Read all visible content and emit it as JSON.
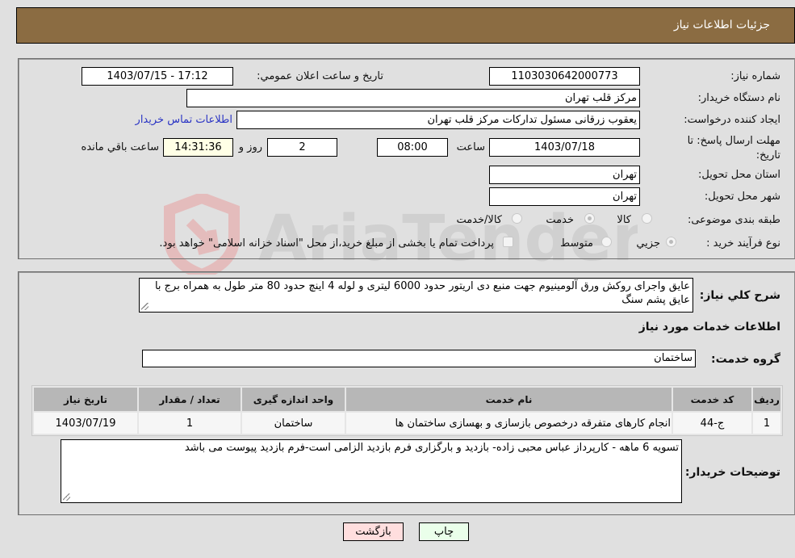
{
  "header": {
    "title": "جزئيات اطلاعات نياز"
  },
  "details": {
    "need_number": {
      "label": "شماره نياز:",
      "value": "1103030642000773"
    },
    "announce_datetime": {
      "label": "تاريخ و ساعت اعلان عمومي:",
      "value": "1403/07/15 - 17:12"
    },
    "buyer_org": {
      "label": "نام دستگاه خريدار:",
      "value": "مرکز قلب تهران"
    },
    "requester": {
      "label": "ايجاد كننده درخواست:",
      "value": "یعقوب زرقانی مسئول تداركات مرکز قلب تهران"
    },
    "buyer_contact_link": "اطلاعات تماس خريدار",
    "deadline": {
      "label": "مهلت ارسال پاسخ: تا تاريخ:",
      "date": "1403/07/18",
      "time_label": "ساعت",
      "time": "08:00",
      "days": "2",
      "days_label": "روز و",
      "remaining": "14:31:36",
      "remaining_label": "ساعت باقي مانده"
    },
    "province": {
      "label": "استان محل تحويل:",
      "value": "تهران"
    },
    "city": {
      "label": "شهر محل تحويل:",
      "value": "تهران"
    },
    "category": {
      "label": "طبقه بندی موضوعی:",
      "options": [
        "کالا",
        "خدمت",
        "کالا/خدمت"
      ],
      "selected": "خدمت"
    },
    "purchase_type": {
      "label": "نوع فرآيند خريد :",
      "options": [
        "جزيي",
        "متوسط"
      ],
      "selected": "جزيي",
      "treasury_note": "پرداخت تمام يا بخشی از مبلغ خريد،از محل \"اسناد خزانه اسلامی\" خواهد بود."
    }
  },
  "summary": {
    "label": "شرح کلي نياز:",
    "value": "عايق واجرای روکش ورق آلومينيوم جهت منبع دی اريتور حدود 6000 ليتری و لوله 4 اينچ حدود 80 متر طول به همراه برج با عايق پشم سنگ"
  },
  "services": {
    "section_title": "اطلاعات خدمات مورد نياز",
    "group_label": "گروه خدمت:",
    "group_value": "ساختمان",
    "table": {
      "headers": [
        "رديف",
        "کد خدمت",
        "نام خدمت",
        "واحد اندازه گيری",
        "تعداد / مقدار",
        "تاريخ نياز"
      ],
      "rows": [
        [
          "1",
          "ج-44",
          "انجام کارهای متفرقه درخصوص بازسازی و بهسازی ساختمان ها",
          "ساختمان",
          "1",
          "1403/07/19"
        ]
      ]
    }
  },
  "buyer_notes": {
    "label": "توضيحات خريدار:",
    "value": "تسويه 6 ماهه - کارپرداز عباس محبی زاده- بازديد و بارگزاری فرم بازديد الزامی است-فرم بازديد پيوست می باشد"
  },
  "buttons": {
    "back": "بازگشت",
    "print": "چاپ"
  },
  "watermark": {
    "text": "AriaTender.neT"
  },
  "colors": {
    "header_bg": "#8b6c42",
    "back_btn_bg": "#ffdede",
    "print_btn_bg": "#eaffea",
    "link": "#2a34c4"
  }
}
